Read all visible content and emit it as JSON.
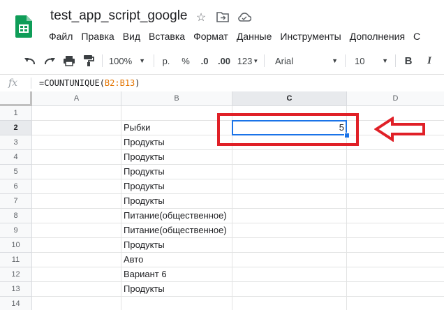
{
  "doc": {
    "title": "test_app_script_google"
  },
  "menu": [
    "Файл",
    "Правка",
    "Вид",
    "Вставка",
    "Формат",
    "Данные",
    "Инструменты",
    "Дополнения",
    "С"
  ],
  "toolbar": {
    "zoom": "100%",
    "currency": "р.",
    "percent": "%",
    "dec_decrease": ".0",
    "dec_increase": ".00",
    "more_formats": "123",
    "font": "Arial",
    "font_size": "10",
    "bold": "B"
  },
  "formula_bar": {
    "fx": "fx",
    "prefix": "=COUNTUNIQUE(",
    "range": "B2:B13",
    "suffix": ")"
  },
  "columns": [
    "A",
    "B",
    "C",
    "D"
  ],
  "rows": [
    "1",
    "2",
    "3",
    "4",
    "5",
    "6",
    "7",
    "8",
    "9",
    "10",
    "11",
    "12",
    "13",
    "14"
  ],
  "cells": {
    "B": [
      "",
      "Рыбки",
      "Продукты",
      "Продукты",
      "Продукты",
      "Продукты",
      "Продукты",
      "Питание(общественное)",
      "Питание(общественное)",
      "Продукты",
      "Авто",
      "Вариант 6",
      "Продукты",
      ""
    ],
    "C2": "5"
  },
  "selected_cell": "C2",
  "colors": {
    "selection": "#1a73e8",
    "annotation": "#e02027",
    "sheets_green": "#0f9d58"
  },
  "icons": [
    "star-icon",
    "move-to-folder-icon",
    "cloud-status-icon",
    "undo-icon",
    "redo-icon",
    "print-icon",
    "paint-format-icon",
    "dropdown-arrow-icon",
    "red-arrow-annotation"
  ]
}
